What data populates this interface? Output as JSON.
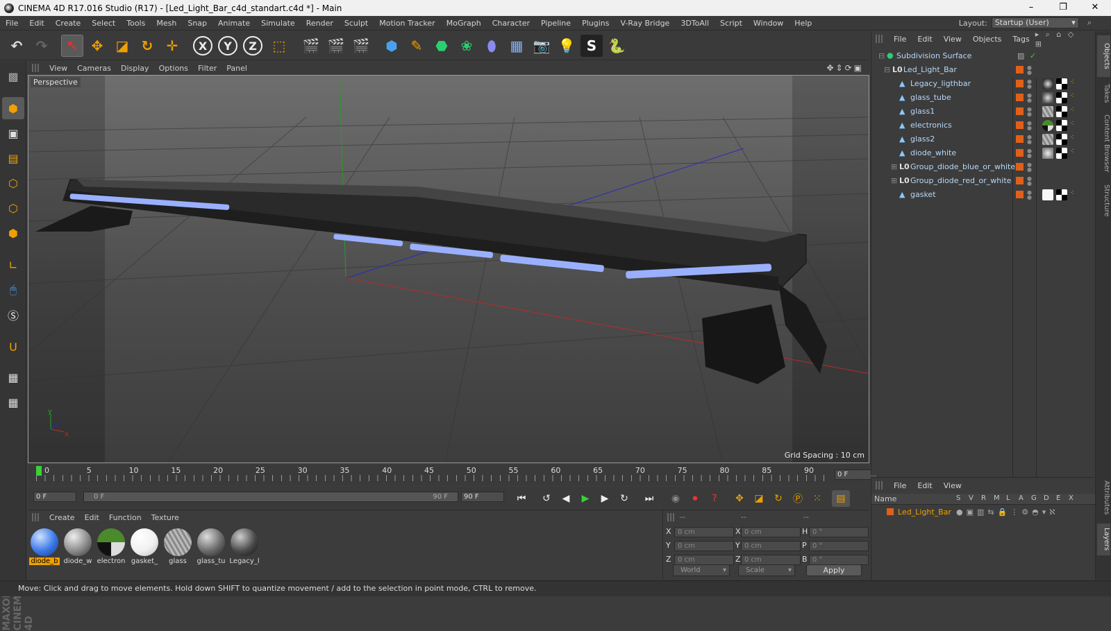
{
  "window": {
    "title": "CINEMA 4D R17.016 Studio (R17) - [Led_Light_Bar_c4d_standart.c4d *] - Main",
    "minimize": "–",
    "maximize": "❐",
    "close": "✕"
  },
  "menu": [
    "File",
    "Edit",
    "Create",
    "Select",
    "Tools",
    "Mesh",
    "Snap",
    "Animate",
    "Simulate",
    "Render",
    "Sculpt",
    "Motion Tracker",
    "MoGraph",
    "Character",
    "Pipeline",
    "Plugins",
    "V-Ray Bridge",
    "3DToAll",
    "Script",
    "Window",
    "Help"
  ],
  "layout": {
    "label": "Layout:",
    "value": "Startup (User)"
  },
  "toolbar": {
    "axis_x": "X",
    "axis_y": "Y",
    "axis_z": "Z"
  },
  "viewport": {
    "menu": [
      "View",
      "Cameras",
      "Display",
      "Options",
      "Filter",
      "Panel"
    ],
    "camera_label": "Perspective",
    "grid_spacing": "Grid Spacing : 10 cm",
    "axis_y": "y",
    "axis_x": "x"
  },
  "timeline": {
    "ticks": [
      "0",
      "5",
      "10",
      "15",
      "20",
      "25",
      "30",
      "35",
      "40",
      "45",
      "50",
      "55",
      "60",
      "65",
      "70",
      "75",
      "80",
      "85",
      "90"
    ],
    "current_frame": "0 F",
    "start_frame": "0 F",
    "slider_start": "0 F",
    "slider_end": "90 F",
    "end_frame": "90 F"
  },
  "material_manager": {
    "menu": [
      "Create",
      "Edit",
      "Function",
      "Texture"
    ],
    "materials": [
      {
        "name": "diode_b",
        "color": "#3a78e8"
      },
      {
        "name": "diode_w",
        "color": "#8a8a8a"
      },
      {
        "name": "electron",
        "color": "#4a8a2a"
      },
      {
        "name": "gasket_",
        "color": "#f0f0f0"
      },
      {
        "name": "glass",
        "color": "#9a9a9a"
      },
      {
        "name": "glass_tu",
        "color": "#6a6a6a"
      },
      {
        "name": "Legacy_l",
        "color": "#4a4a4a"
      }
    ]
  },
  "coordinates": {
    "headers": [
      "--",
      "--",
      "--"
    ],
    "labels_pos": [
      "X",
      "Y",
      "Z"
    ],
    "labels_size": [
      "X",
      "Y",
      "Z"
    ],
    "labels_rot": [
      "H",
      "P",
      "B"
    ],
    "pos": [
      "0 cm",
      "0 cm",
      "0 cm"
    ],
    "size": [
      "0 cm",
      "0 cm",
      "0 cm"
    ],
    "rot": [
      "0 °",
      "0 °",
      "0 °"
    ],
    "mode": "World",
    "scale": "Scale",
    "apply": "Apply"
  },
  "object_manager": {
    "menu": [
      "File",
      "Edit",
      "View",
      "Objects",
      "Tags"
    ],
    "objects": [
      {
        "name": "Subdivision Surface",
        "indent": 0,
        "type": "subdivision-icon"
      },
      {
        "name": "Led_Light_Bar",
        "indent": 1,
        "type": "null-icon"
      },
      {
        "name": "Legacy_ligthbar",
        "indent": 2,
        "type": "polygon-icon"
      },
      {
        "name": "glass_tube",
        "indent": 2,
        "type": "polygon-icon"
      },
      {
        "name": "glass1",
        "indent": 2,
        "type": "polygon-icon"
      },
      {
        "name": "electronics",
        "indent": 2,
        "type": "polygon-icon"
      },
      {
        "name": "glass2",
        "indent": 2,
        "type": "polygon-icon"
      },
      {
        "name": "diode_white",
        "indent": 2,
        "type": "polygon-icon"
      },
      {
        "name": "Group_diode_blue_or_white",
        "indent": 2,
        "type": "null-icon"
      },
      {
        "name": "Group_diode_red_or_white",
        "indent": 2,
        "type": "null-icon"
      },
      {
        "name": "gasket",
        "indent": 2,
        "type": "polygon-icon"
      }
    ]
  },
  "layer_manager": {
    "menu": [
      "File",
      "Edit",
      "View"
    ],
    "header_name": "Name",
    "columns": [
      "S",
      "V",
      "R",
      "M",
      "L",
      "A",
      "G",
      "D",
      "E",
      "X"
    ],
    "layers": [
      {
        "name": "Led_Light_Bar",
        "color": "#e0601a"
      }
    ]
  },
  "right_tabs": [
    "Objects",
    "Takes",
    "Content Browser",
    "Structure",
    "Attributes",
    "Layers"
  ],
  "brand": "MAXON CINEMA 4D",
  "status": "Move: Click and drag to move elements. Hold down SHIFT to quantize movement / add to the selection in point mode, CTRL to remove."
}
